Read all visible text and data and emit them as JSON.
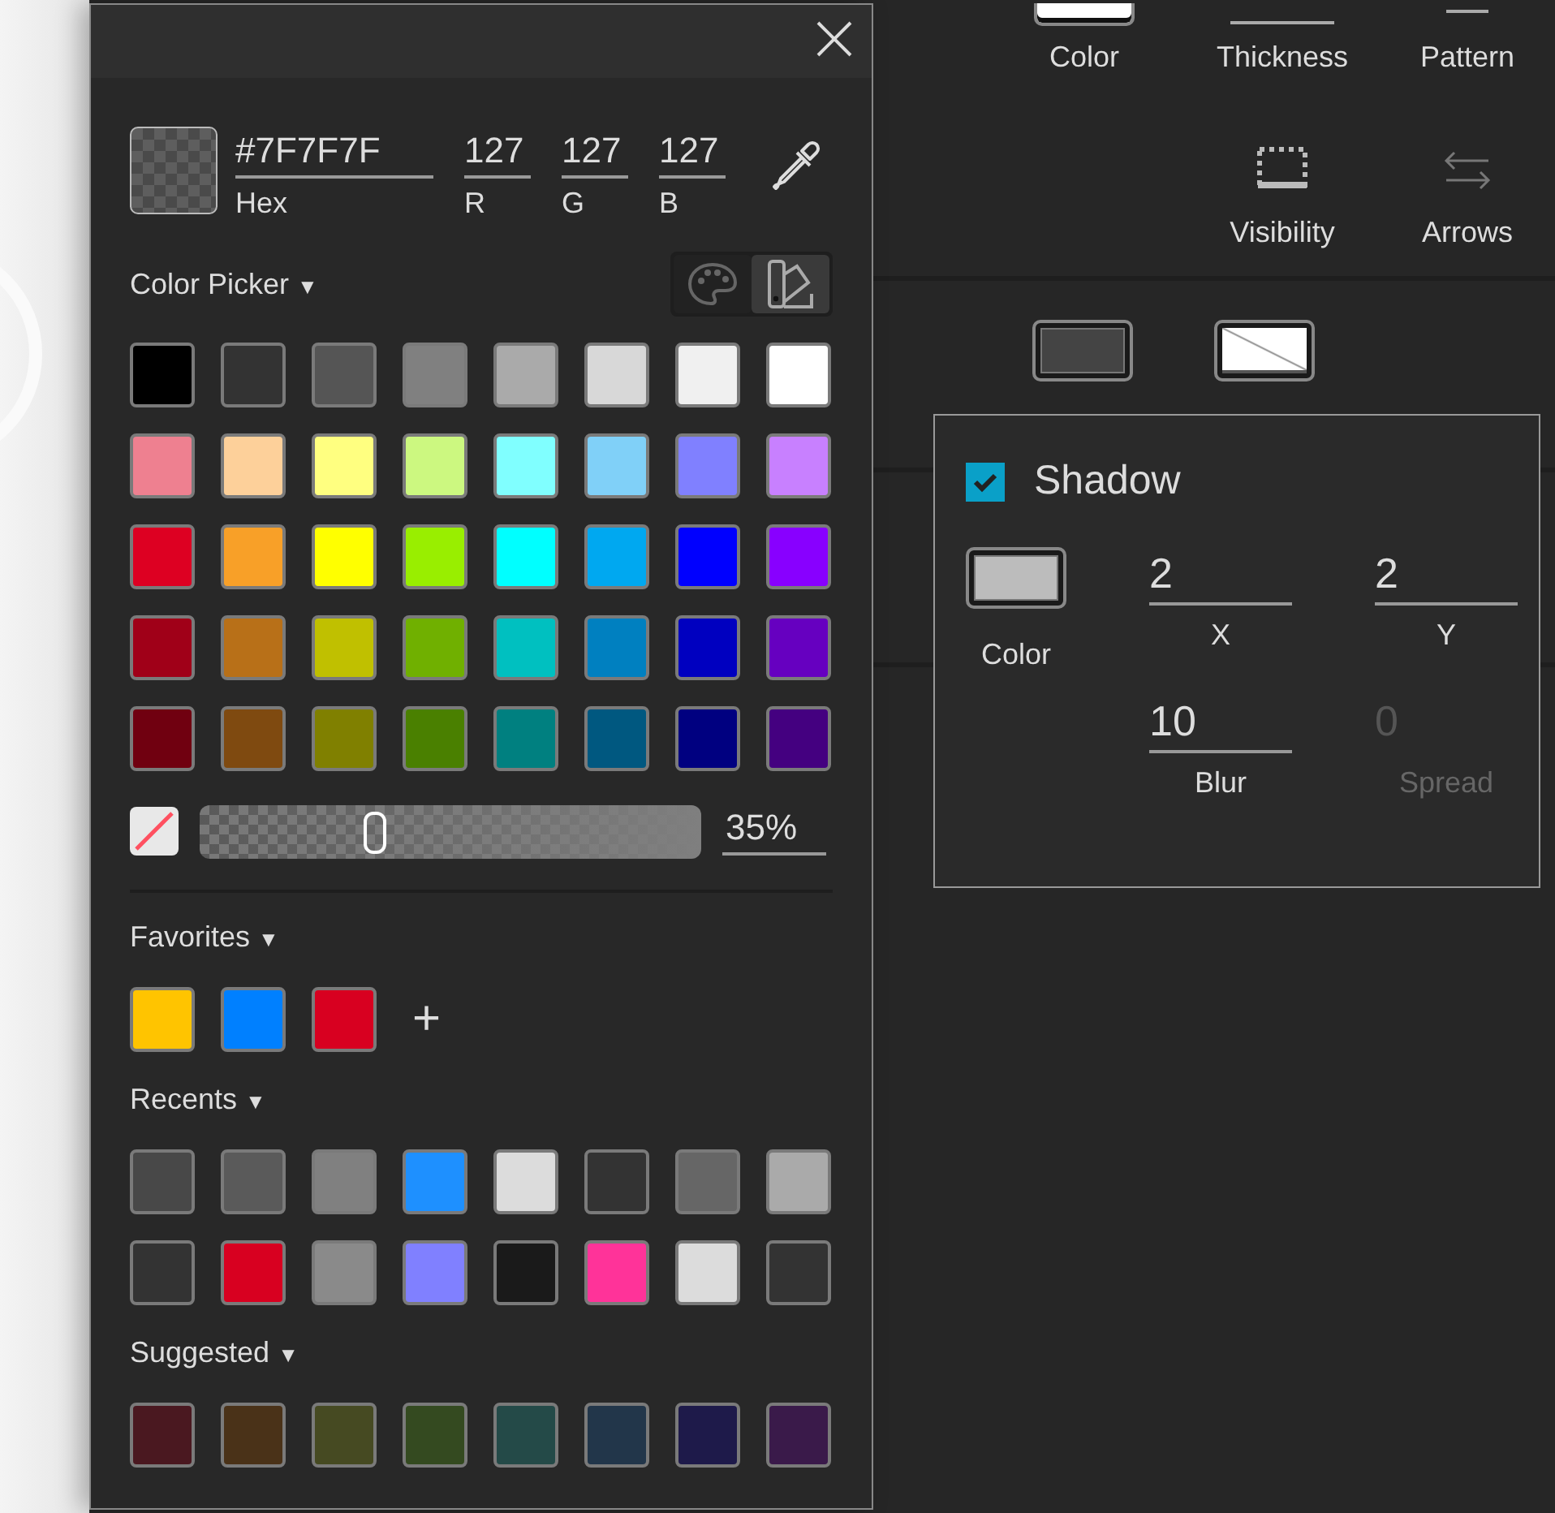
{
  "tool_rows": [
    {
      "tools": [
        {
          "kind": "color",
          "label": "Color"
        },
        {
          "kind": "thickness",
          "label": "Thickness"
        },
        {
          "kind": "pattern",
          "label": "Pattern"
        }
      ]
    },
    {
      "tools": [
        {
          "kind": "visibility",
          "label": "Visibility"
        },
        {
          "kind": "arrows",
          "label": "Arrows"
        }
      ]
    }
  ],
  "fill_styles": [
    {
      "kind": "solid"
    },
    {
      "kind": "none"
    }
  ],
  "shadow": {
    "label": "Shadow",
    "checked": true,
    "color_label": "Color",
    "fields": [
      {
        "value": "2",
        "label": "X",
        "disabled": false
      },
      {
        "value": "2",
        "label": "Y",
        "disabled": false
      },
      {
        "value": "10",
        "label": "Blur",
        "disabled": false
      },
      {
        "value": "0",
        "label": "Spread",
        "disabled": true
      }
    ]
  },
  "picker": {
    "hex": {
      "value": "#7F7F7F",
      "label": "Hex"
    },
    "channels": [
      {
        "value": "127",
        "label": "R"
      },
      {
        "value": "127",
        "label": "G"
      },
      {
        "value": "127",
        "label": "B"
      }
    ],
    "mode": {
      "label": "Color Picker",
      "caret": "▼"
    },
    "views": [
      {
        "kind": "palette",
        "selected": false
      },
      {
        "kind": "swatches",
        "selected": true
      }
    ],
    "palette_rows": [
      {
        "swatches": [
          {
            "color": "#000000"
          },
          {
            "color": "#333333"
          },
          {
            "color": "#555555"
          },
          {
            "color": "#808080"
          },
          {
            "color": "#aaaaaa"
          },
          {
            "color": "#d8d8d8"
          },
          {
            "color": "#f0f0f0"
          },
          {
            "color": "#ffffff"
          }
        ]
      },
      {
        "swatches": [
          {
            "color": "#ee8090"
          },
          {
            "color": "#fdd09a"
          },
          {
            "color": "#ffff80"
          },
          {
            "color": "#ccf880"
          },
          {
            "color": "#80ffff"
          },
          {
            "color": "#80d0f8"
          },
          {
            "color": "#8080ff"
          },
          {
            "color": "#c880ff"
          }
        ]
      },
      {
        "swatches": [
          {
            "color": "#dd0022"
          },
          {
            "color": "#f8a028"
          },
          {
            "color": "#ffff00"
          },
          {
            "color": "#99ee00"
          },
          {
            "color": "#00ffff"
          },
          {
            "color": "#00a8f0"
          },
          {
            "color": "#0000ff"
          },
          {
            "color": "#8800ff"
          }
        ]
      },
      {
        "swatches": [
          {
            "color": "#a00018"
          },
          {
            "color": "#b87018"
          },
          {
            "color": "#c0c000"
          },
          {
            "color": "#70b000"
          },
          {
            "color": "#00c0c0"
          },
          {
            "color": "#0080c0"
          },
          {
            "color": "#0000c0"
          },
          {
            "color": "#6600c0"
          }
        ]
      },
      {
        "swatches": [
          {
            "color": "#700010"
          },
          {
            "color": "#7f4a10"
          },
          {
            "color": "#808000"
          },
          {
            "color": "#4a8000"
          },
          {
            "color": "#008080"
          },
          {
            "color": "#005880"
          },
          {
            "color": "#000080"
          },
          {
            "color": "#440080"
          }
        ]
      }
    ],
    "opacity": {
      "level": 0.35,
      "reading": "35%"
    },
    "sections": [
      {
        "title": "Favorites",
        "caret": "▼",
        "add": "+",
        "rows": [
          {
            "swatches": [
              {
                "color": "#ffc400"
              },
              {
                "color": "#0080ff"
              },
              {
                "color": "#d80020"
              }
            ]
          }
        ]
      },
      {
        "title": "Recents",
        "caret": "▼",
        "rows": [
          {
            "swatches": [
              {
                "color": "#484848"
              },
              {
                "color": "#5a5a5a"
              },
              {
                "color": "#808080"
              },
              {
                "color": "#1e90ff"
              },
              {
                "color": "#dcdcdc"
              },
              {
                "color": "#333333"
              },
              {
                "color": "#666666"
              },
              {
                "color": "#aaaaaa"
              }
            ]
          },
          {
            "swatches": [
              {
                "color": "#333333"
              },
              {
                "color": "#d80020"
              },
              {
                "color": "#8a8a8a"
              },
              {
                "color": "#8080ff"
              },
              {
                "color": "#1a1a1a"
              },
              {
                "color": "#ff3399"
              },
              {
                "color": "#dcdcdc"
              },
              {
                "color": "#333333"
              }
            ]
          }
        ]
      },
      {
        "title": "Suggested",
        "caret": "▼",
        "rows": [
          {
            "swatches": [
              {
                "color": "#4a1820"
              },
              {
                "color": "#4a3218"
              },
              {
                "color": "#464a22"
              },
              {
                "color": "#344a20"
              },
              {
                "color": "#244a48"
              },
              {
                "color": "#22364a"
              },
              {
                "color": "#1e1a4a"
              },
              {
                "color": "#3a1a4a"
              }
            ]
          }
        ]
      }
    ]
  }
}
